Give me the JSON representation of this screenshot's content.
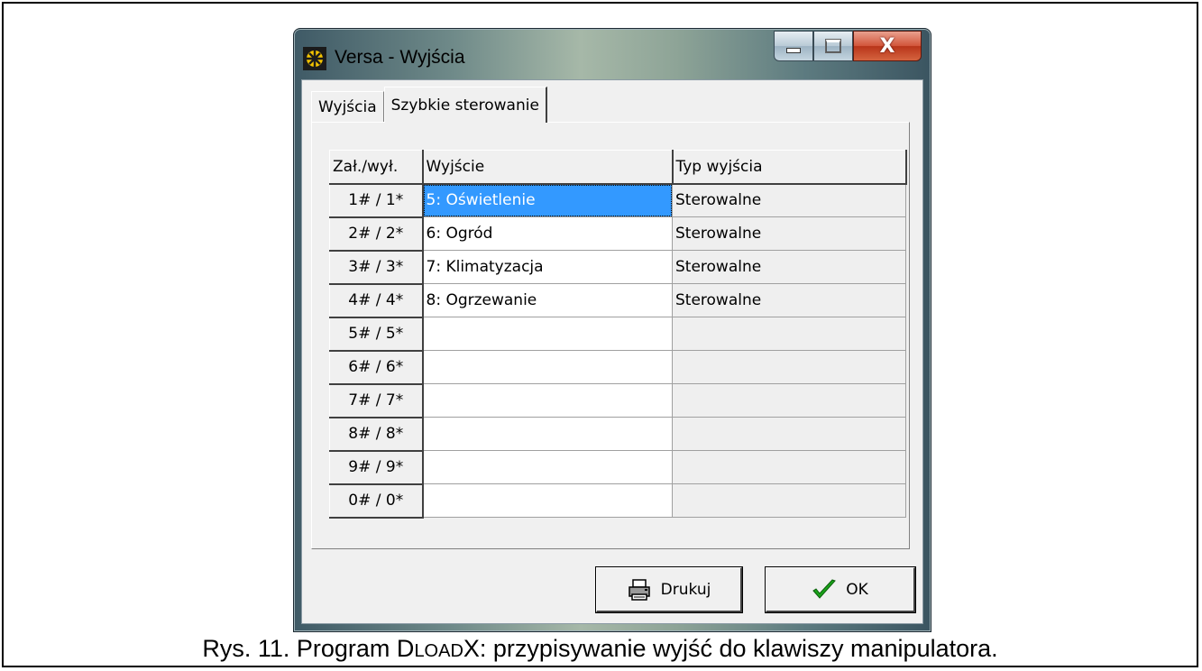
{
  "window": {
    "title": "Versa - Wyjścia",
    "controls": {
      "minimize": "minimize",
      "maximize": "maximize",
      "close": "X"
    }
  },
  "tabs": [
    {
      "label": "Wyjścia",
      "active": false
    },
    {
      "label": "Szybkie sterowanie",
      "active": true
    }
  ],
  "grid": {
    "headers": {
      "key": "Zał./wył.",
      "output": "Wyjście",
      "type": "Typ wyjścia"
    },
    "rows": [
      {
        "key": "1# / 1*",
        "output": "5: Oświetlenie",
        "type": "Sterowalne"
      },
      {
        "key": "2# / 2*",
        "output": "6: Ogród",
        "type": "Sterowalne"
      },
      {
        "key": "3# / 3*",
        "output": "7: Klimatyzacja",
        "type": "Sterowalne"
      },
      {
        "key": "4# / 4*",
        "output": "8: Ogrzewanie",
        "type": "Sterowalne"
      },
      {
        "key": "5# / 5*",
        "output": "",
        "type": ""
      },
      {
        "key": "6# / 6*",
        "output": "",
        "type": ""
      },
      {
        "key": "7# / 7*",
        "output": "",
        "type": ""
      },
      {
        "key": "8# / 8*",
        "output": "",
        "type": ""
      },
      {
        "key": "9# / 9*",
        "output": "",
        "type": ""
      },
      {
        "key": "0# / 0*",
        "output": "",
        "type": ""
      }
    ],
    "selected_cell": "5: Oświetlenie"
  },
  "buttons": {
    "print": "Drukuj",
    "ok": "OK"
  },
  "icons": {
    "app": "app-icon",
    "print": "printer-icon",
    "ok": "checkmark-icon"
  },
  "caption": {
    "prefix": "Rys. 11. Program D",
    "small_caps": "LOAD",
    "suffix": "X: przypisywanie wyjść do klawiszy manipulatora."
  },
  "colors": {
    "selection": "#3399ff",
    "checkmark": "#1aa31a",
    "app_icon": "#f5c400"
  }
}
